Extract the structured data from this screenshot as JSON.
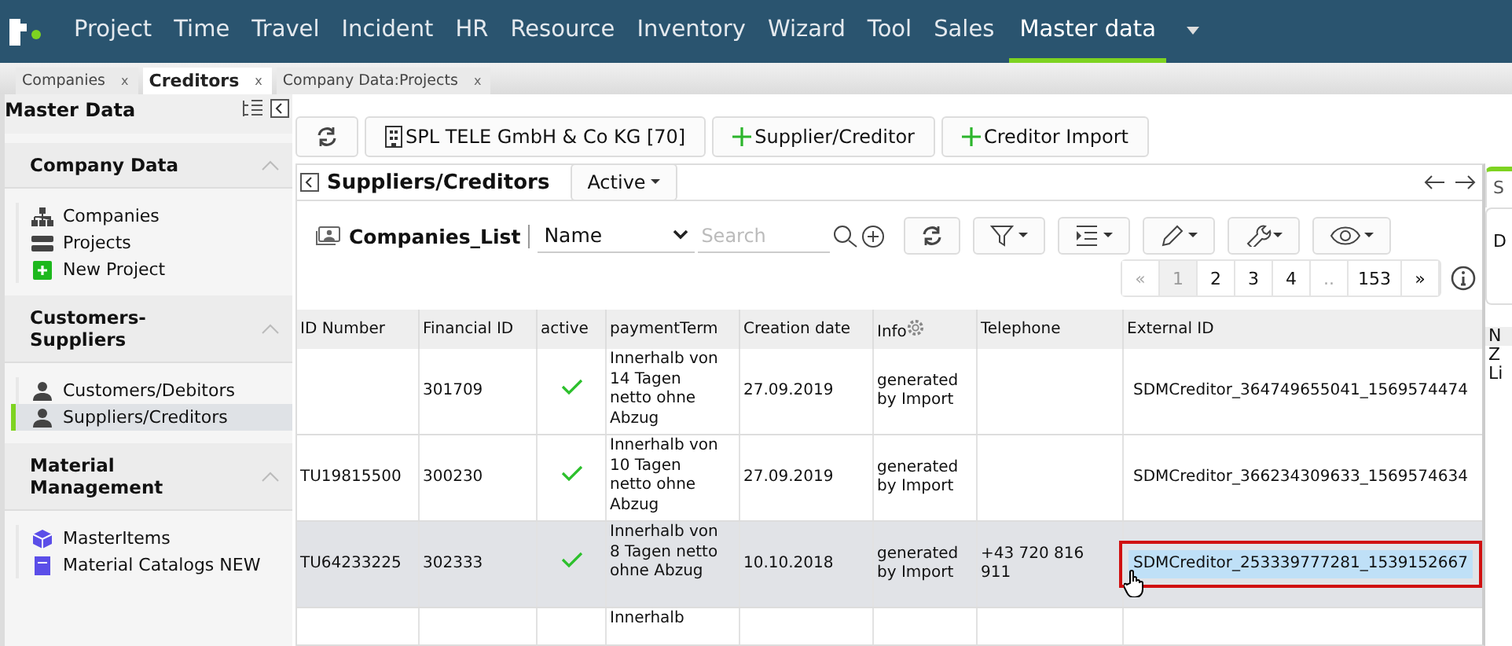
{
  "nav": {
    "items": [
      {
        "label": "Project",
        "selected": false
      },
      {
        "label": "Time",
        "selected": false
      },
      {
        "label": "Travel",
        "selected": false
      },
      {
        "label": "Incident",
        "selected": false
      },
      {
        "label": "HR",
        "selected": false
      },
      {
        "label": "Resource",
        "selected": false
      },
      {
        "label": "Inventory",
        "selected": false
      },
      {
        "label": "Wizard",
        "selected": false
      },
      {
        "label": "Tool",
        "selected": false
      },
      {
        "label": "Sales",
        "selected": false
      },
      {
        "label": "Master data",
        "selected": true
      }
    ]
  },
  "tabs": [
    {
      "label": "Companies",
      "selected": false,
      "close": "x"
    },
    {
      "label": "Creditors",
      "selected": true,
      "close": "x"
    },
    {
      "label": "Company Data:Projects",
      "selected": false,
      "close": "x"
    }
  ],
  "sidebar": {
    "title": "Master Data",
    "sections": [
      {
        "title": "Company Data",
        "expanded": true,
        "items": [
          {
            "label": "Companies",
            "kind": "org",
            "selected": false
          },
          {
            "label": "Projects",
            "kind": "server",
            "selected": false
          },
          {
            "label": "New Project",
            "kind": "add",
            "selected": false
          }
        ]
      },
      {
        "title": "Customers-Suppliers",
        "expanded": true,
        "items": [
          {
            "label": "Customers/Debitors",
            "kind": "person",
            "selected": false
          },
          {
            "label": "Suppliers/Creditors",
            "kind": "person",
            "selected": true
          }
        ]
      },
      {
        "title": "Material Management",
        "expanded": true,
        "items": [
          {
            "label": "MasterItems",
            "kind": "cube",
            "selected": false
          },
          {
            "label": "Material Catalogs NEW",
            "kind": "catalog",
            "selected": false
          }
        ]
      }
    ]
  },
  "toolbar": {
    "company": "SPL TELE GmbH & Co KG [70]",
    "buttons": [
      "Supplier/Creditor",
      "Creditor Import"
    ]
  },
  "panel": {
    "title": "Suppliers/Creditors",
    "filter": "Active"
  },
  "list": {
    "title": "Companies_List",
    "sort_field": "Name",
    "search": {
      "placeholder": "Search"
    },
    "pagination": [
      {
        "label": "«",
        "selected": false,
        "disabled": true
      },
      {
        "label": "1",
        "selected": true,
        "disabled": false
      },
      {
        "label": "2",
        "selected": false,
        "disabled": false
      },
      {
        "label": "3",
        "selected": false,
        "disabled": false
      },
      {
        "label": "4",
        "selected": false,
        "disabled": false
      },
      {
        "label": "..",
        "selected": false,
        "disabled": true
      },
      {
        "label": "153",
        "selected": false,
        "disabled": false
      },
      {
        "label": "»",
        "selected": false,
        "disabled": false
      }
    ]
  },
  "table": {
    "columns": [
      "ID Number",
      "Financial ID",
      "active",
      "paymentTerm",
      "Creation date",
      "Info",
      "Telephone",
      "External ID"
    ],
    "rows": [
      {
        "id_number": "",
        "financial_id": "301709",
        "active": true,
        "payment_term": "Innerhalb von 14 Tagen netto ohne Abzug",
        "creation_date": "27.09.2019",
        "info": "generated by Import",
        "telephone": "",
        "external_id": "SDMCreditor_364749655041_1569574474",
        "selected": false,
        "highlighted": false
      },
      {
        "id_number": "TU19815500",
        "financial_id": "300230",
        "active": true,
        "payment_term": "Innerhalb von 10 Tagen netto ohne Abzug",
        "creation_date": "27.09.2019",
        "info": "generated by Import",
        "telephone": "",
        "external_id": "SDMCreditor_366234309633_1569574634",
        "selected": false,
        "highlighted": false
      },
      {
        "id_number": "TU64233225",
        "financial_id": "302333",
        "active": true,
        "payment_term": "Innerhalb von 8 Tagen netto ohne Abzug",
        "creation_date": "10.10.2018",
        "info": "generated by Import",
        "telephone": "+43 720 816 911",
        "external_id": "SDMCreditor_253339777281_1539152667",
        "selected": true,
        "highlighted": true
      },
      {
        "id_number": "",
        "financial_id": "",
        "payment_term": "Innerhalb",
        "creation_date": "",
        "info": "",
        "telephone": "",
        "external_id": "",
        "selected": false
      }
    ]
  },
  "right_panel": {
    "texts": [
      "S",
      "D",
      "N",
      "Z",
      "Li"
    ]
  }
}
